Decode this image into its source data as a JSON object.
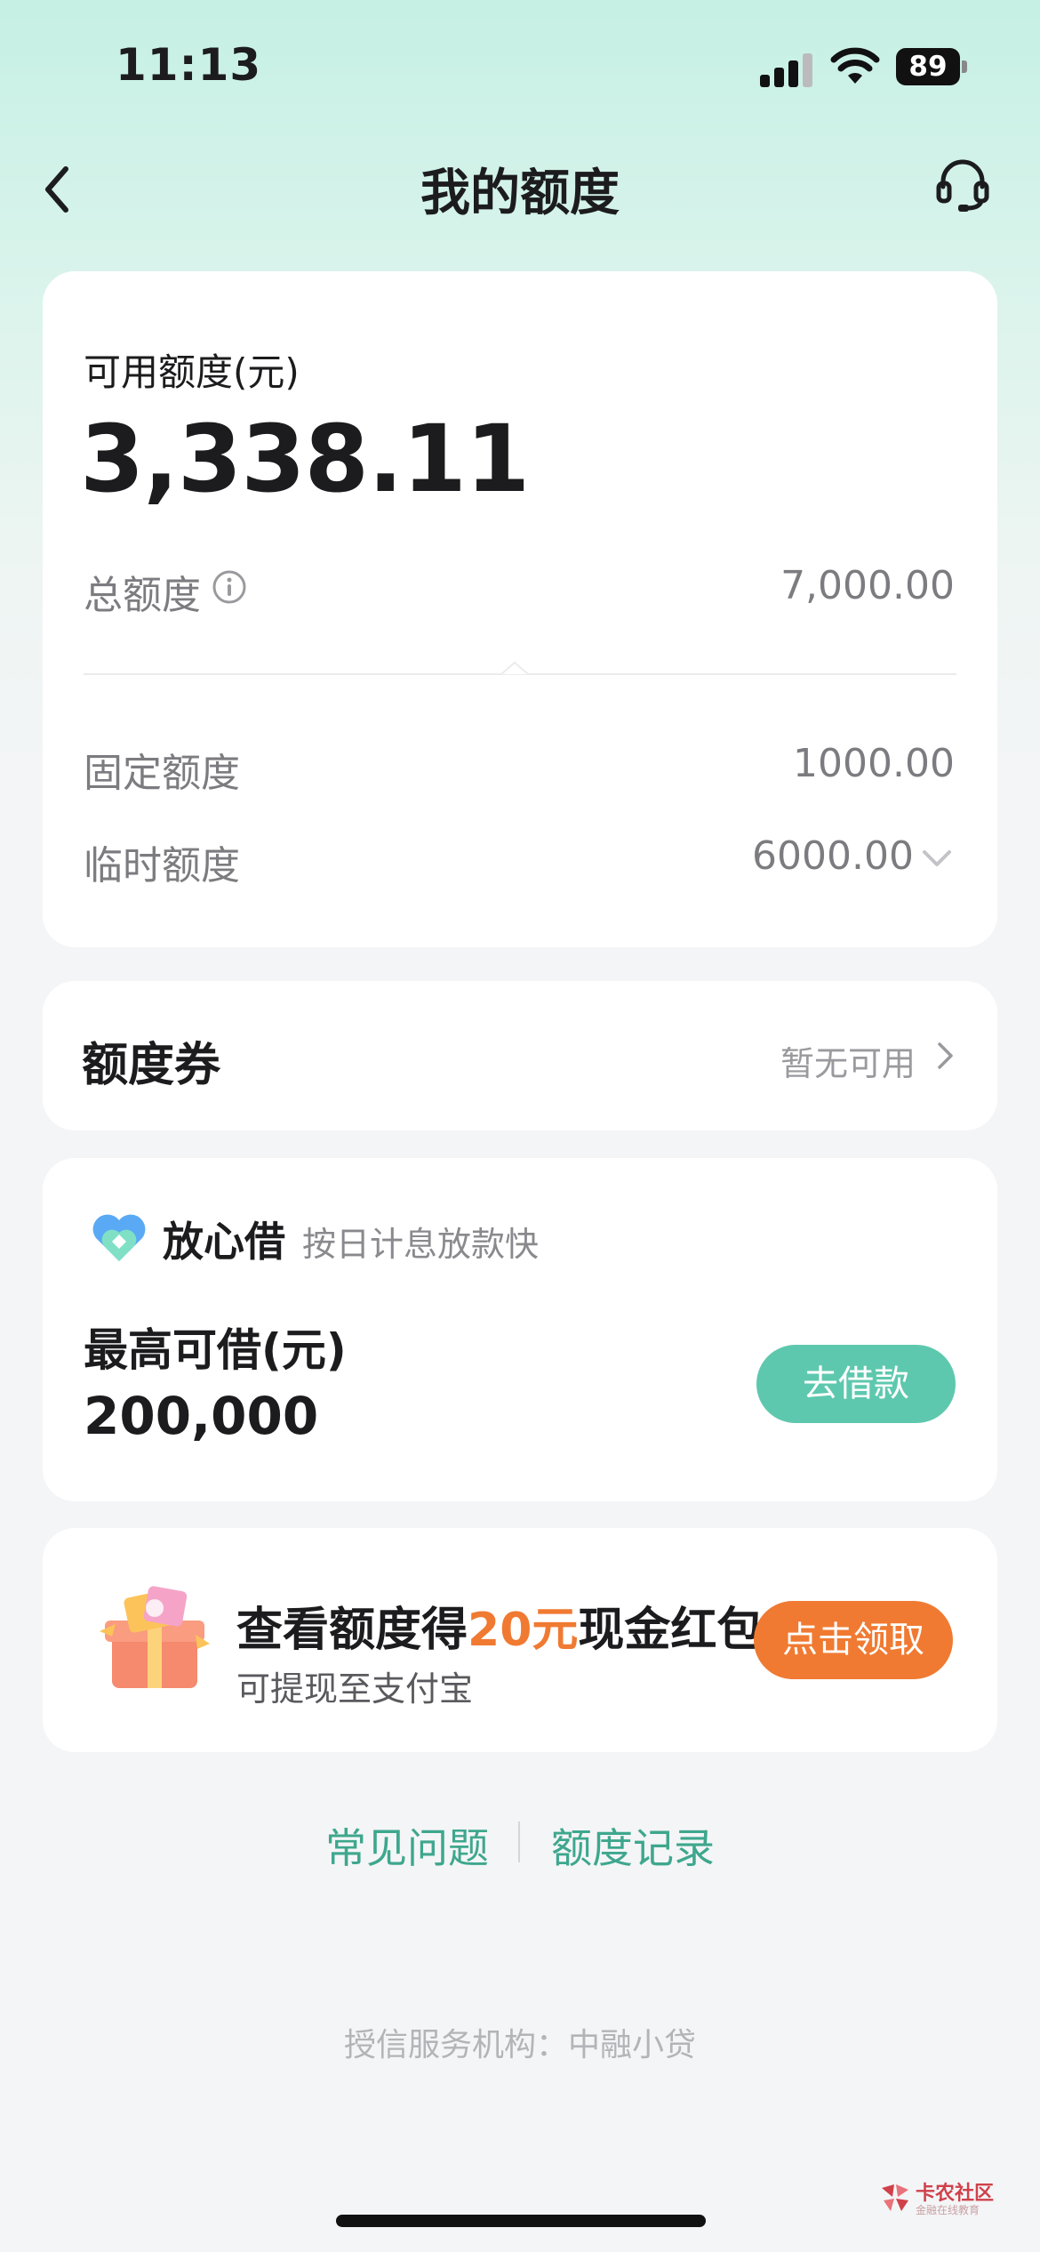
{
  "status_bar": {
    "time": "11:13",
    "battery": "89"
  },
  "nav": {
    "title": "我的额度",
    "back_icon": "chevron-left-icon",
    "service_icon": "headset-icon"
  },
  "quota": {
    "available_label": "可用额度(元)",
    "available_amount": "3,338.11",
    "total_label": "总额度",
    "total_value": "7,000.00",
    "fixed_label": "固定额度",
    "fixed_value": "1000.00",
    "temp_label": "临时额度",
    "temp_value": "6000.00"
  },
  "coupon": {
    "title": "额度券",
    "status": "暂无可用"
  },
  "loan": {
    "brand": "放心借",
    "slogan": "按日计息放款快",
    "max_label": "最高可借(元)",
    "max_value": "200,000",
    "button": "去借款"
  },
  "promo": {
    "title_prefix": "查看额度得",
    "title_highlight": "20元",
    "title_suffix": "现金红包",
    "subtitle": "可提现至支付宝",
    "button": "点击领取"
  },
  "links": {
    "faq": "常见问题",
    "records": "额度记录"
  },
  "footer": {
    "org": "授信服务机构：中融小贷"
  },
  "watermark": {
    "text": "卡农社区",
    "sub": "金融在线教育"
  },
  "colors": {
    "accent_green": "#5ec8ae",
    "link_green": "#3ea78d",
    "promo_orange": "#f07a32"
  }
}
